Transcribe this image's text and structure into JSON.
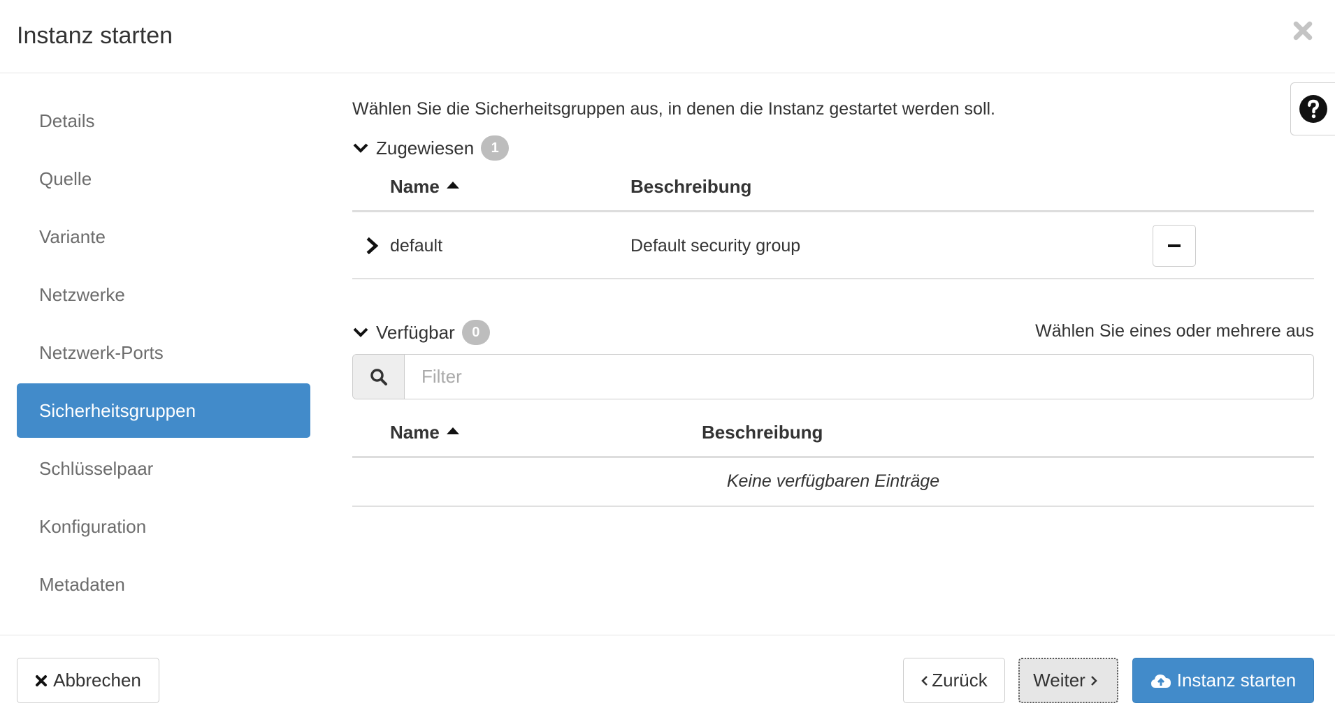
{
  "modal": {
    "title": "Instanz starten",
    "close_icon": "close-icon",
    "help_icon": "question-circle-icon"
  },
  "sidebar": {
    "items": [
      {
        "label": "Details",
        "active": false
      },
      {
        "label": "Quelle",
        "active": false
      },
      {
        "label": "Variante",
        "active": false
      },
      {
        "label": "Netzwerke",
        "active": false
      },
      {
        "label": "Netzwerk-Ports",
        "active": false
      },
      {
        "label": "Sicherheitsgruppen",
        "active": true
      },
      {
        "label": "Schlüsselpaar",
        "active": false
      },
      {
        "label": "Konfiguration",
        "active": false
      },
      {
        "label": "Metadaten",
        "active": false
      }
    ]
  },
  "main": {
    "intro": "Wählen Sie die Sicherheitsgruppen aus, in denen die Instanz gestartet werden soll.",
    "allocated": {
      "title": "Zugewiesen",
      "count": "1",
      "columns": {
        "name": "Name",
        "description": "Beschreibung"
      },
      "rows": [
        {
          "name": "default",
          "description": "Default security group"
        }
      ]
    },
    "available": {
      "title": "Verfügbar",
      "count": "0",
      "hint": "Wählen Sie eines oder mehrere aus",
      "filter_placeholder": "Filter",
      "columns": {
        "name": "Name",
        "description": "Beschreibung"
      },
      "empty_text": "Keine verfügbaren Einträge"
    }
  },
  "footer": {
    "cancel_label": "Abbrechen",
    "back_label": "Zurück",
    "next_label": "Weiter",
    "launch_label": "Instanz starten"
  },
  "colors": {
    "primary": "#428bca",
    "badge": "#bdbdbd"
  }
}
